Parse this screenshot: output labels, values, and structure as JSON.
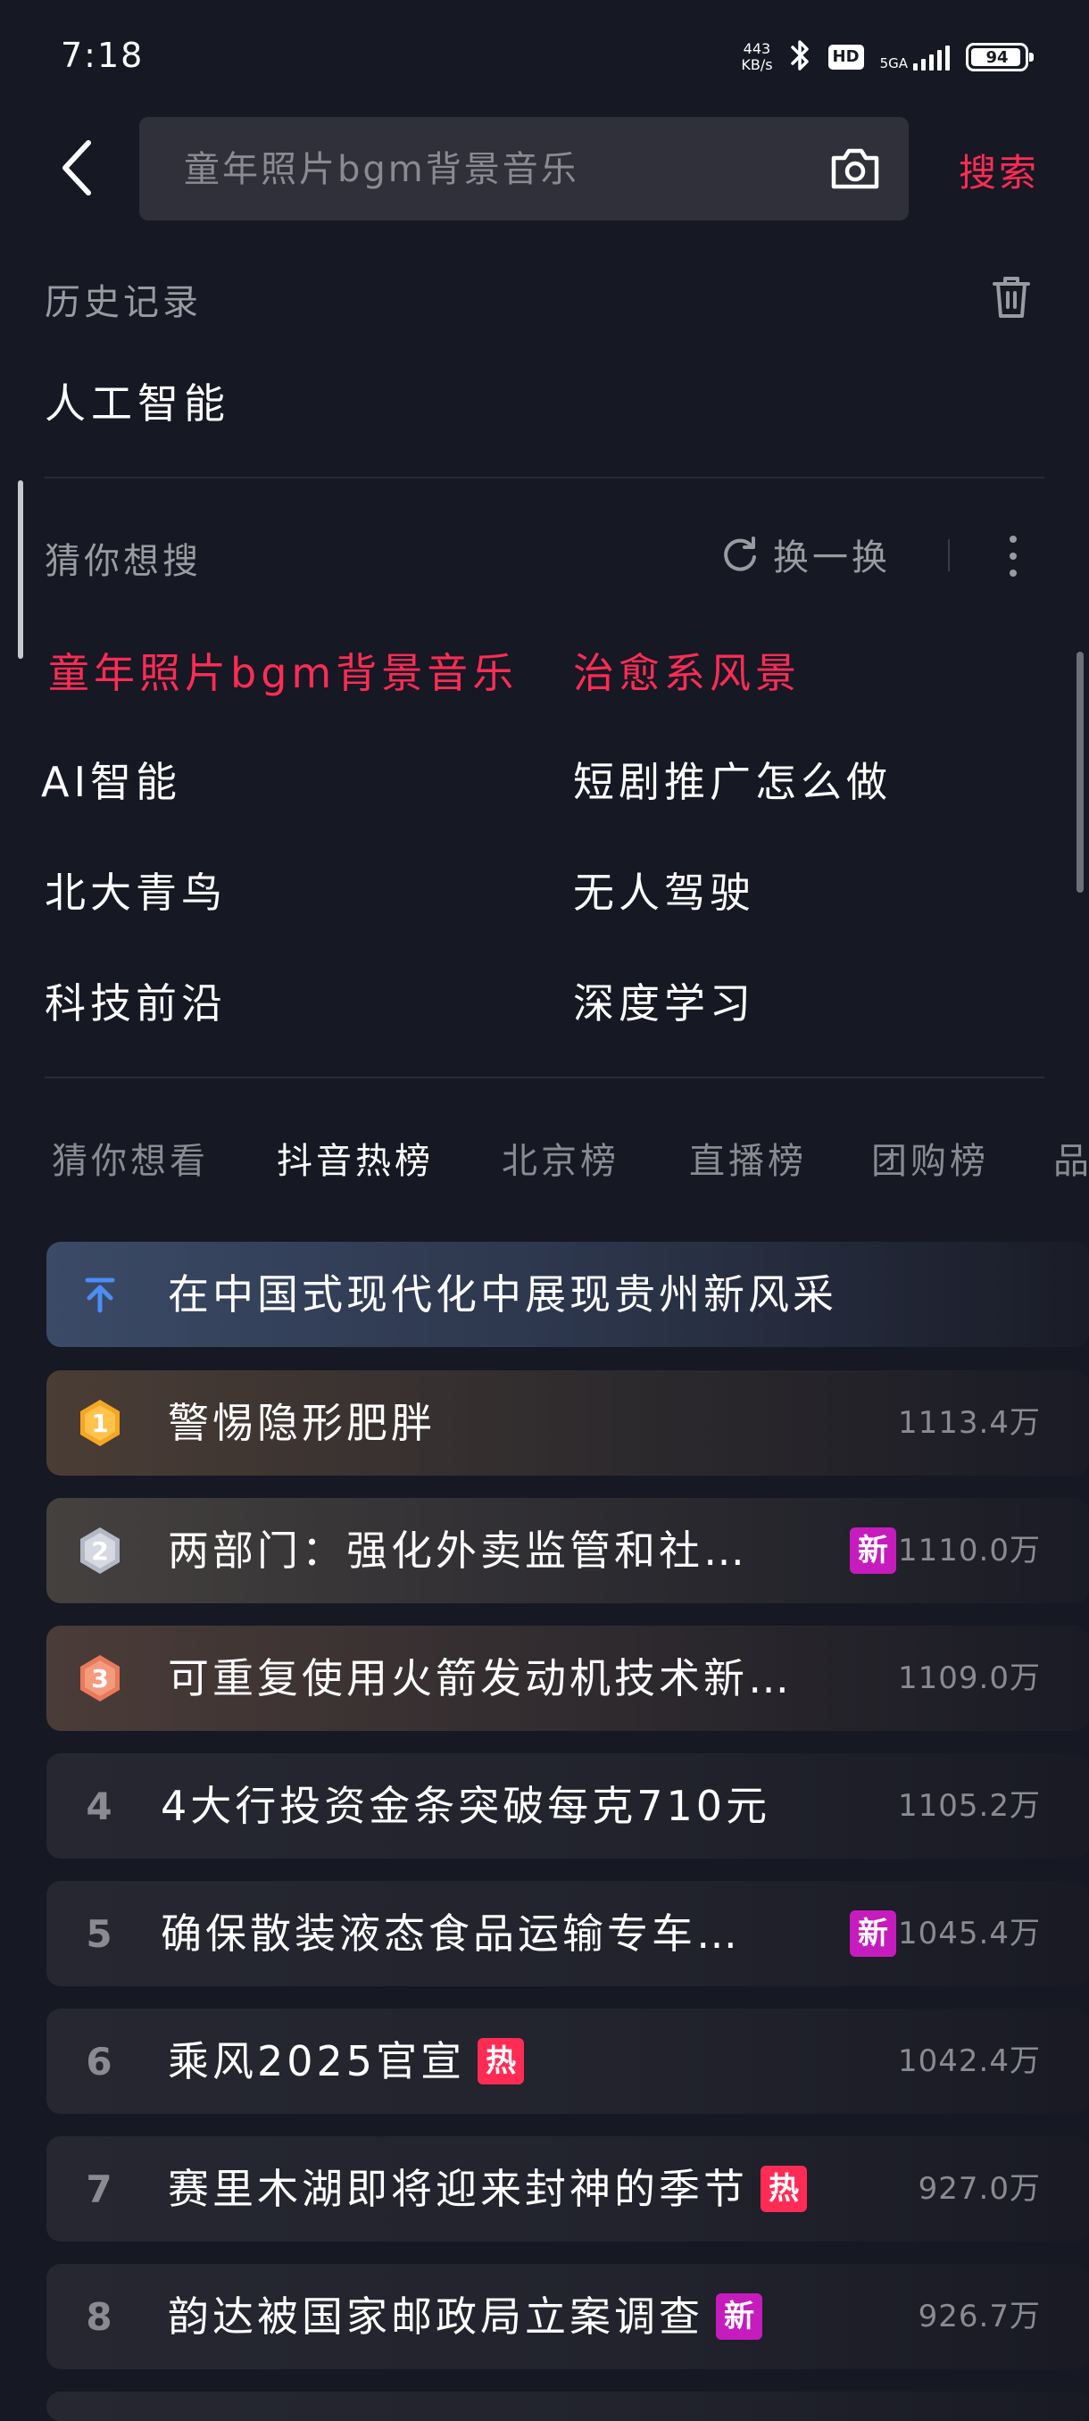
{
  "status_bar": {
    "time": "7:18",
    "net_speed_value": "443",
    "net_speed_unit": "KB/s",
    "hd_label": "HD",
    "network_label": "5GA",
    "battery": "94"
  },
  "search": {
    "placeholder": "童年照片bgm背景音乐",
    "submit_label": "搜索"
  },
  "history": {
    "title": "历史记录",
    "items": [
      "人工智能"
    ]
  },
  "guess": {
    "title": "猜你想搜",
    "refresh_label": "换一换",
    "items": [
      {
        "label": "童年照片bgm背景音乐",
        "hot": true
      },
      {
        "label": "治愈系风景",
        "hot": true
      },
      {
        "label": "AI智能",
        "hot": false
      },
      {
        "label": "短剧推广怎么做",
        "hot": false
      },
      {
        "label": "北大青鸟",
        "hot": false
      },
      {
        "label": "无人驾驶",
        "hot": false
      },
      {
        "label": "科技前沿",
        "hot": false
      },
      {
        "label": "深度学习",
        "hot": false
      }
    ]
  },
  "tabs": [
    {
      "label": "猜你想看",
      "active": false
    },
    {
      "label": "抖音热榜",
      "active": true
    },
    {
      "label": "北京榜",
      "active": false
    },
    {
      "label": "直播榜",
      "active": false
    },
    {
      "label": "团购榜",
      "active": false
    },
    {
      "label": "品",
      "active": false
    }
  ],
  "ranking": {
    "pinned": {
      "title": "在中国式现代化中展现贵州新风采"
    },
    "items": [
      {
        "rank": "1",
        "title": "警惕隐形肥胖",
        "heat": "1113.4万",
        "tag": ""
      },
      {
        "rank": "2",
        "title": "两部门：强化外卖监管和社…",
        "heat": "1110.0万",
        "tag": "新"
      },
      {
        "rank": "3",
        "title": "可重复使用火箭发动机技术新…",
        "heat": "1109.0万",
        "tag": ""
      },
      {
        "rank": "4",
        "title": "4大行投资金条突破每克710元",
        "heat": "1105.2万",
        "tag": ""
      },
      {
        "rank": "5",
        "title": "确保散装液态食品运输专车…",
        "heat": "1045.4万",
        "tag": "新"
      },
      {
        "rank": "6",
        "title": "乘风2025官宣",
        "heat": "1042.4万",
        "tag": "热"
      },
      {
        "rank": "7",
        "title": "赛里木湖即将迎来封神的季节",
        "heat": "927.0万",
        "tag": "热"
      },
      {
        "rank": "8",
        "title": "韵达被国家邮政局立案调查",
        "heat": "926.7万",
        "tag": "新"
      }
    ]
  },
  "colors": {
    "background": "#161823",
    "accent": "#fe2c55",
    "tag_new": "#c61cbd",
    "tag_hot": "#fe2c55",
    "medal_gold": "#f5a623",
    "medal_silver": "#c9ccd6",
    "medal_bronze": "#f08a6a",
    "pin_arrow": "#4d8cf5"
  }
}
